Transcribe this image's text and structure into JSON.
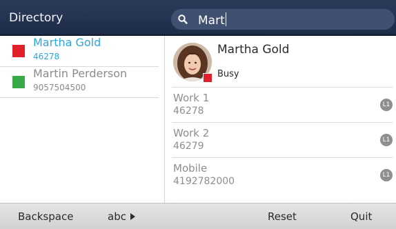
{
  "header": {
    "title": "Directory",
    "search_value": "Mart",
    "search_icon": "search-icon"
  },
  "results": [
    {
      "name": "Martha Gold",
      "number": "46278",
      "presence_color": "#e0202a",
      "selected": true
    },
    {
      "name": "Martin Perderson",
      "number": "9057504500",
      "presence_color": "#3aaa48",
      "selected": false
    }
  ],
  "detail": {
    "name": "Martha Gold",
    "status": "Busy",
    "status_color": "#e0202a",
    "phones": [
      {
        "label": "Work 1",
        "number": "46278",
        "line": "L1"
      },
      {
        "label": "Work 2",
        "number": "46279",
        "line": "L1"
      },
      {
        "label": "Mobile",
        "number": "4192782000",
        "line": "L1"
      }
    ]
  },
  "softkeys": {
    "backspace": "Backspace",
    "abc": "abc",
    "reset": "Reset",
    "quit": "Quit"
  },
  "colors": {
    "accent": "#2aa7df",
    "header_bg": "#22324f",
    "busy": "#e0202a",
    "available": "#3aaa48"
  }
}
